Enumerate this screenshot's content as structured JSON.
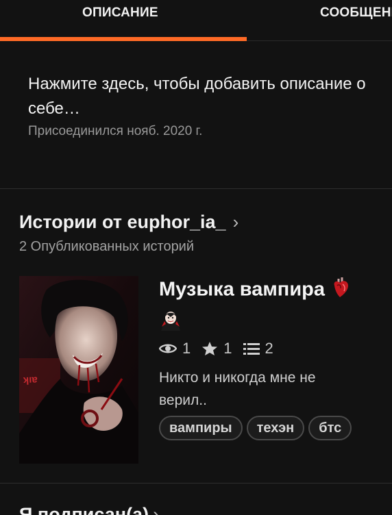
{
  "tabs": {
    "description": "ОПИСАНИЕ",
    "messages": "СООБЩЕНИЯ"
  },
  "profile": {
    "description_prompt": "Нажмите здесь, чтобы добавить описание о себе…",
    "description_line1": "Нажмите здесь, чтобы добавить описание о",
    "description_line2": "себе…",
    "joined": "Присоединился нояб. 2020 г."
  },
  "stories": {
    "title": "Истории от euphor_ia_",
    "count": "2 Опубликованных историй",
    "items": [
      {
        "title": "Музыка вампира",
        "reads": "1",
        "votes": "1",
        "parts": "2",
        "description_line1": "Никто и никогда мне не",
        "description_line2": "верил..",
        "tags": [
          "вампиры",
          "техэн",
          "бтс"
        ]
      }
    ]
  },
  "following": {
    "title": "Я подписан(а)"
  },
  "icons": {
    "reads": "eye-icon",
    "votes": "star-icon",
    "parts": "list-icon",
    "chevron": "chevron-right-icon",
    "emoji_heart": "anatomical-heart-icon",
    "emoji_vampire": "vampire-icon"
  },
  "colors": {
    "accent": "#ff6a26",
    "background": "#121212"
  }
}
